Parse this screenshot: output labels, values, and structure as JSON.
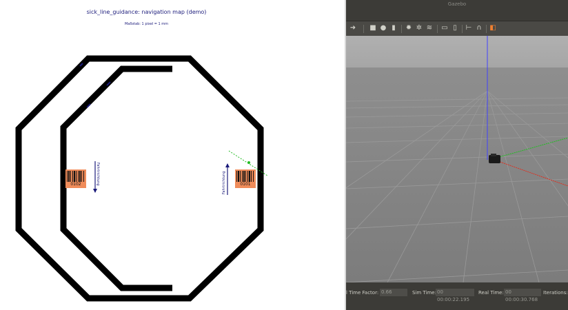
{
  "map": {
    "title": "sick_line_guidance: navigation map (demo)",
    "scale": "Maßstab: 1 pixel = 1 mm",
    "barcode_left": {
      "code": "0102",
      "direction": "Fahrtrichtung"
    },
    "barcode_right": {
      "code": "0101",
      "direction": "Fahrtrichtung"
    }
  },
  "gazebo": {
    "window_title": "Gazebo",
    "toolbar": {
      "icons": [
        "redo-icon",
        "box-icon",
        "sphere-icon",
        "cylinder-icon",
        "sun-icon",
        "point-light-icon",
        "spot-light-icon",
        "copy-icon",
        "paste-icon",
        "align-icon",
        "magnet-icon",
        "screenshot-icon"
      ]
    },
    "status": {
      "rtf_label": "l Time Factor:",
      "rtf_value": "0.66",
      "sim_label": "Sim Time:",
      "sim_value": "00 00:00:22.195",
      "real_label": "Real Time:",
      "real_value": "00 00:00:30.768",
      "iter_label": "Iterations:"
    },
    "colors": {
      "panel": "#3c3b37",
      "viewport_sky": "#b2b2b2",
      "ground": "#858585",
      "x_axis": "#e03020",
      "y_axis": "#20c020",
      "z_axis": "#4040ff"
    }
  }
}
